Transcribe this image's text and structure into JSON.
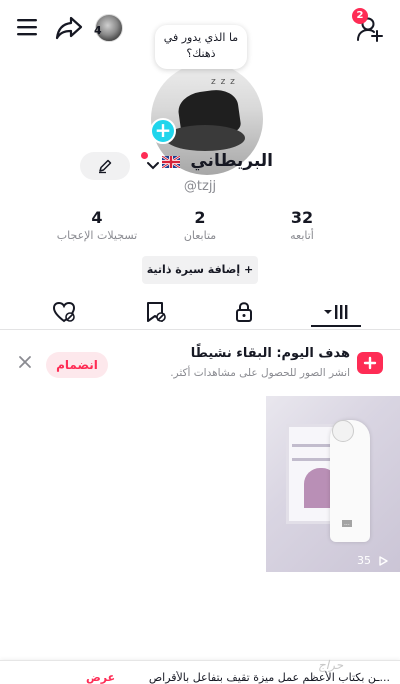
{
  "header": {
    "friends_count": "4",
    "notification_badge": "2"
  },
  "profile": {
    "note": "ما الذي يدور في ذهنك؟",
    "display_name": "البريطاني",
    "flag": "UK-flag",
    "username": "@tzjj",
    "add_bio_label": "+ إضافة سيرة ذاتية"
  },
  "stats": [
    {
      "value": "32",
      "label": "أتابعه"
    },
    {
      "value": "2",
      "label": "متابعان"
    },
    {
      "value": "4",
      "label": "تسجيلات الإعجاب"
    }
  ],
  "tabs": [
    {
      "icon": "grid-icon",
      "active": true
    },
    {
      "icon": "lock-icon",
      "active": false
    },
    {
      "icon": "bookmark-hidden-icon",
      "active": false
    },
    {
      "icon": "liked-hidden-icon",
      "active": false
    }
  ],
  "goal_card": {
    "title": "هدف اليوم: البقاء نشيطًا",
    "subtitle": "انشر الصور للحصول على مشاهدات أكثر.",
    "join_label": "انضمام"
  },
  "videos": [
    {
      "views": "35",
      "caption": "..."
    }
  ],
  "bottom_panel": {
    "text": "...ـن بكتاب الأعظم عمل ميزة تقيف بتفاعل بالأقراص",
    "offer_label": "عرض",
    "watermark": "حراج"
  },
  "colors": {
    "accent": "#fe2c55",
    "cyan": "#20d5ec"
  }
}
